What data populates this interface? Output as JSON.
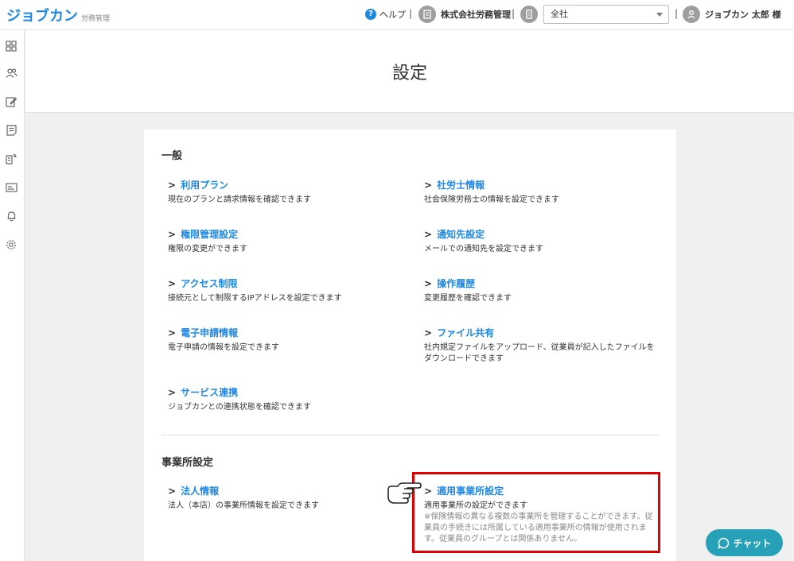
{
  "header": {
    "logo": "ジョブカン",
    "logo_sub": "労務管理",
    "help": "ヘルプ",
    "company": "株式会社労務管理",
    "office_select": "全社",
    "user": "ジョブカン 太郎 様"
  },
  "sidebar": {
    "icons": [
      "dashboard-icon",
      "users-icon",
      "edit-icon",
      "document-icon",
      "form-send-icon",
      "card-icon",
      "bell-icon",
      "gear-icon"
    ]
  },
  "page": {
    "title": "設定"
  },
  "sections": {
    "general": {
      "title": "一般",
      "items": [
        {
          "label": "利用プラン",
          "desc": "現在のプランと請求情報を確認できます"
        },
        {
          "label": "社労士情報",
          "desc": "社会保険労務士の情報を設定できます"
        },
        {
          "label": "権限管理設定",
          "desc": "権限の変更ができます"
        },
        {
          "label": "通知先設定",
          "desc": "メールでの通知先を設定できます"
        },
        {
          "label": "アクセス制限",
          "desc": "接続元として制限するIPアドレスを設定できます"
        },
        {
          "label": "操作履歴",
          "desc": "変更履歴を確認できます"
        },
        {
          "label": "電子申請情報",
          "desc": "電子申請の情報を設定できます"
        },
        {
          "label": "ファイル共有",
          "desc": "社内規定ファイルをアップロード、従業員が記入したファイルをダウンロードできます"
        },
        {
          "label": "サービス連携",
          "desc": "ジョブカンとの連携状態を確認できます"
        }
      ]
    },
    "office": {
      "title": "事業所設定",
      "items": [
        {
          "label": "法人情報",
          "desc": "法人（本店）の事業所情報を設定できます"
        },
        {
          "label": "適用事業所設定",
          "desc": "適用事業所の設定ができます",
          "note": "※保険情報の異なる複数の事業所を管理することができます。従業員の手続きには所属している適用事業所の情報が使用されます。従業員のグループとは関係ありません。"
        }
      ]
    }
  },
  "chat": {
    "label": "チャット"
  }
}
